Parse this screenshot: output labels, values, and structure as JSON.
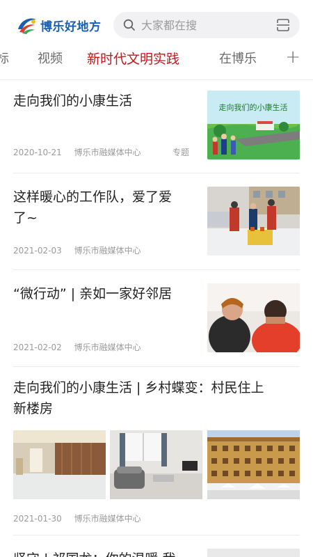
{
  "header": {
    "logo_text": "博乐好地方",
    "search_placeholder": "大家都在搜"
  },
  "tabs": [
    {
      "label": "标"
    },
    {
      "label": "视频"
    },
    {
      "label": "新时代文明实践",
      "active": true
    },
    {
      "label": "在博乐"
    }
  ],
  "add_tab": "+",
  "articles": [
    {
      "title": "走向我们的小康生活",
      "date": "2020-10-21",
      "source": "博乐市融媒体中心",
      "tag": "专题",
      "image_caption": "走向我们的小康生活"
    },
    {
      "title_line1": "这样暖心的工作队，爱了爱",
      "title_line2": "了~",
      "date": "2021-02-03",
      "source": "博乐市融媒体中心"
    },
    {
      "title": "“微行动” | 亲如一家好邻居",
      "date": "2021-02-02",
      "source": "博乐市融媒体中心"
    },
    {
      "title_line1": "走向我们的小康生活 | 乡村蝶变：村民住上",
      "title_line2": "新楼房",
      "date": "2021-01-30",
      "source": "博乐市融媒体中心"
    },
    {
      "title_partial": "坚守 | 祁国龙：你的温暖 我"
    }
  ]
}
